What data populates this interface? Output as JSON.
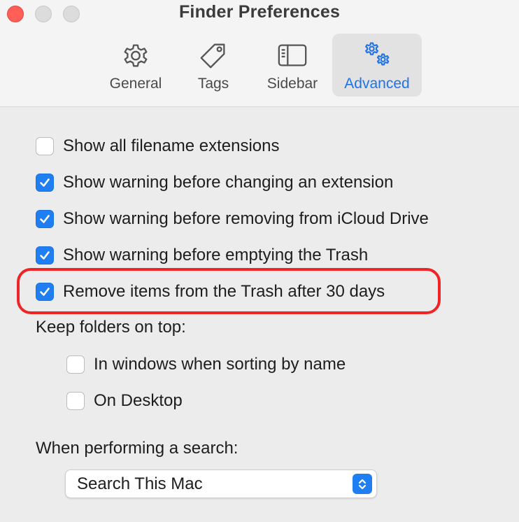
{
  "window": {
    "title": "Finder Preferences"
  },
  "toolbar": {
    "tabs": [
      {
        "label": "General",
        "icon": "gear-icon",
        "selected": false
      },
      {
        "label": "Tags",
        "icon": "tag-icon",
        "selected": false
      },
      {
        "label": "Sidebar",
        "icon": "sidebar-icon",
        "selected": false
      },
      {
        "label": "Advanced",
        "icon": "gears-icon",
        "selected": true
      }
    ]
  },
  "options": [
    {
      "label": "Show all filename extensions",
      "checked": false
    },
    {
      "label": "Show warning before changing an extension",
      "checked": true
    },
    {
      "label": "Show warning before removing from iCloud Drive",
      "checked": true
    },
    {
      "label": "Show warning before emptying the Trash",
      "checked": true
    },
    {
      "label": "Remove items from the Trash after 30 days",
      "checked": true,
      "highlighted": true
    }
  ],
  "keep_folders": {
    "label": "Keep folders on top:",
    "options": [
      {
        "label": "In windows when sorting by name",
        "checked": false
      },
      {
        "label": "On Desktop",
        "checked": false
      }
    ]
  },
  "search": {
    "label": "When performing a search:",
    "selected": "Search This Mac"
  },
  "colors": {
    "accent": "#1f7ff2",
    "highlight": "#ee2426",
    "close": "#ff5f57"
  }
}
